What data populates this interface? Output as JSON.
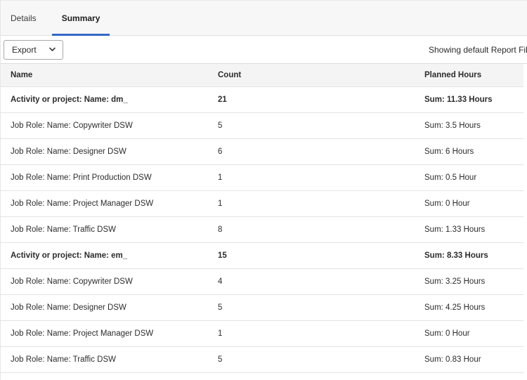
{
  "tabs": [
    {
      "label": "Details",
      "active": false
    },
    {
      "label": "Summary",
      "active": true
    }
  ],
  "toolbar": {
    "export_label": "Export",
    "filter_note": "Showing default Report Fil"
  },
  "table": {
    "columns": [
      "Name",
      "Count",
      "Planned Hours"
    ],
    "rows": [
      {
        "name": "Activity or project: Name: dm_",
        "count": "21",
        "hours": "Sum: 11.33 Hours",
        "group": true
      },
      {
        "name": "Job Role: Name: Copywriter DSW",
        "count": "5",
        "hours": "Sum: 3.5 Hours",
        "group": false
      },
      {
        "name": "Job Role: Name: Designer DSW",
        "count": "6",
        "hours": "Sum: 6 Hours",
        "group": false
      },
      {
        "name": "Job Role: Name: Print Production DSW",
        "count": "1",
        "hours": "Sum: 0.5 Hour",
        "group": false
      },
      {
        "name": "Job Role: Name: Project Manager DSW",
        "count": "1",
        "hours": "Sum: 0 Hour",
        "group": false
      },
      {
        "name": "Job Role: Name: Traffic DSW",
        "count": "8",
        "hours": "Sum: 1.33 Hours",
        "group": false
      },
      {
        "name": "Activity or project: Name: em_",
        "count": "15",
        "hours": "Sum: 8.33 Hours",
        "group": true
      },
      {
        "name": "Job Role: Name: Copywriter DSW",
        "count": "4",
        "hours": "Sum: 3.25 Hours",
        "group": false
      },
      {
        "name": "Job Role: Name: Designer DSW",
        "count": "5",
        "hours": "Sum: 4.25 Hours",
        "group": false
      },
      {
        "name": "Job Role: Name: Project Manager DSW",
        "count": "1",
        "hours": "Sum: 0 Hour",
        "group": false
      },
      {
        "name": "Job Role: Name: Traffic DSW",
        "count": "5",
        "hours": "Sum: 0.83 Hour",
        "group": false
      }
    ]
  },
  "colors": {
    "tab_active_underline": "#3468c9",
    "header_bg": "#f4f4f4"
  }
}
